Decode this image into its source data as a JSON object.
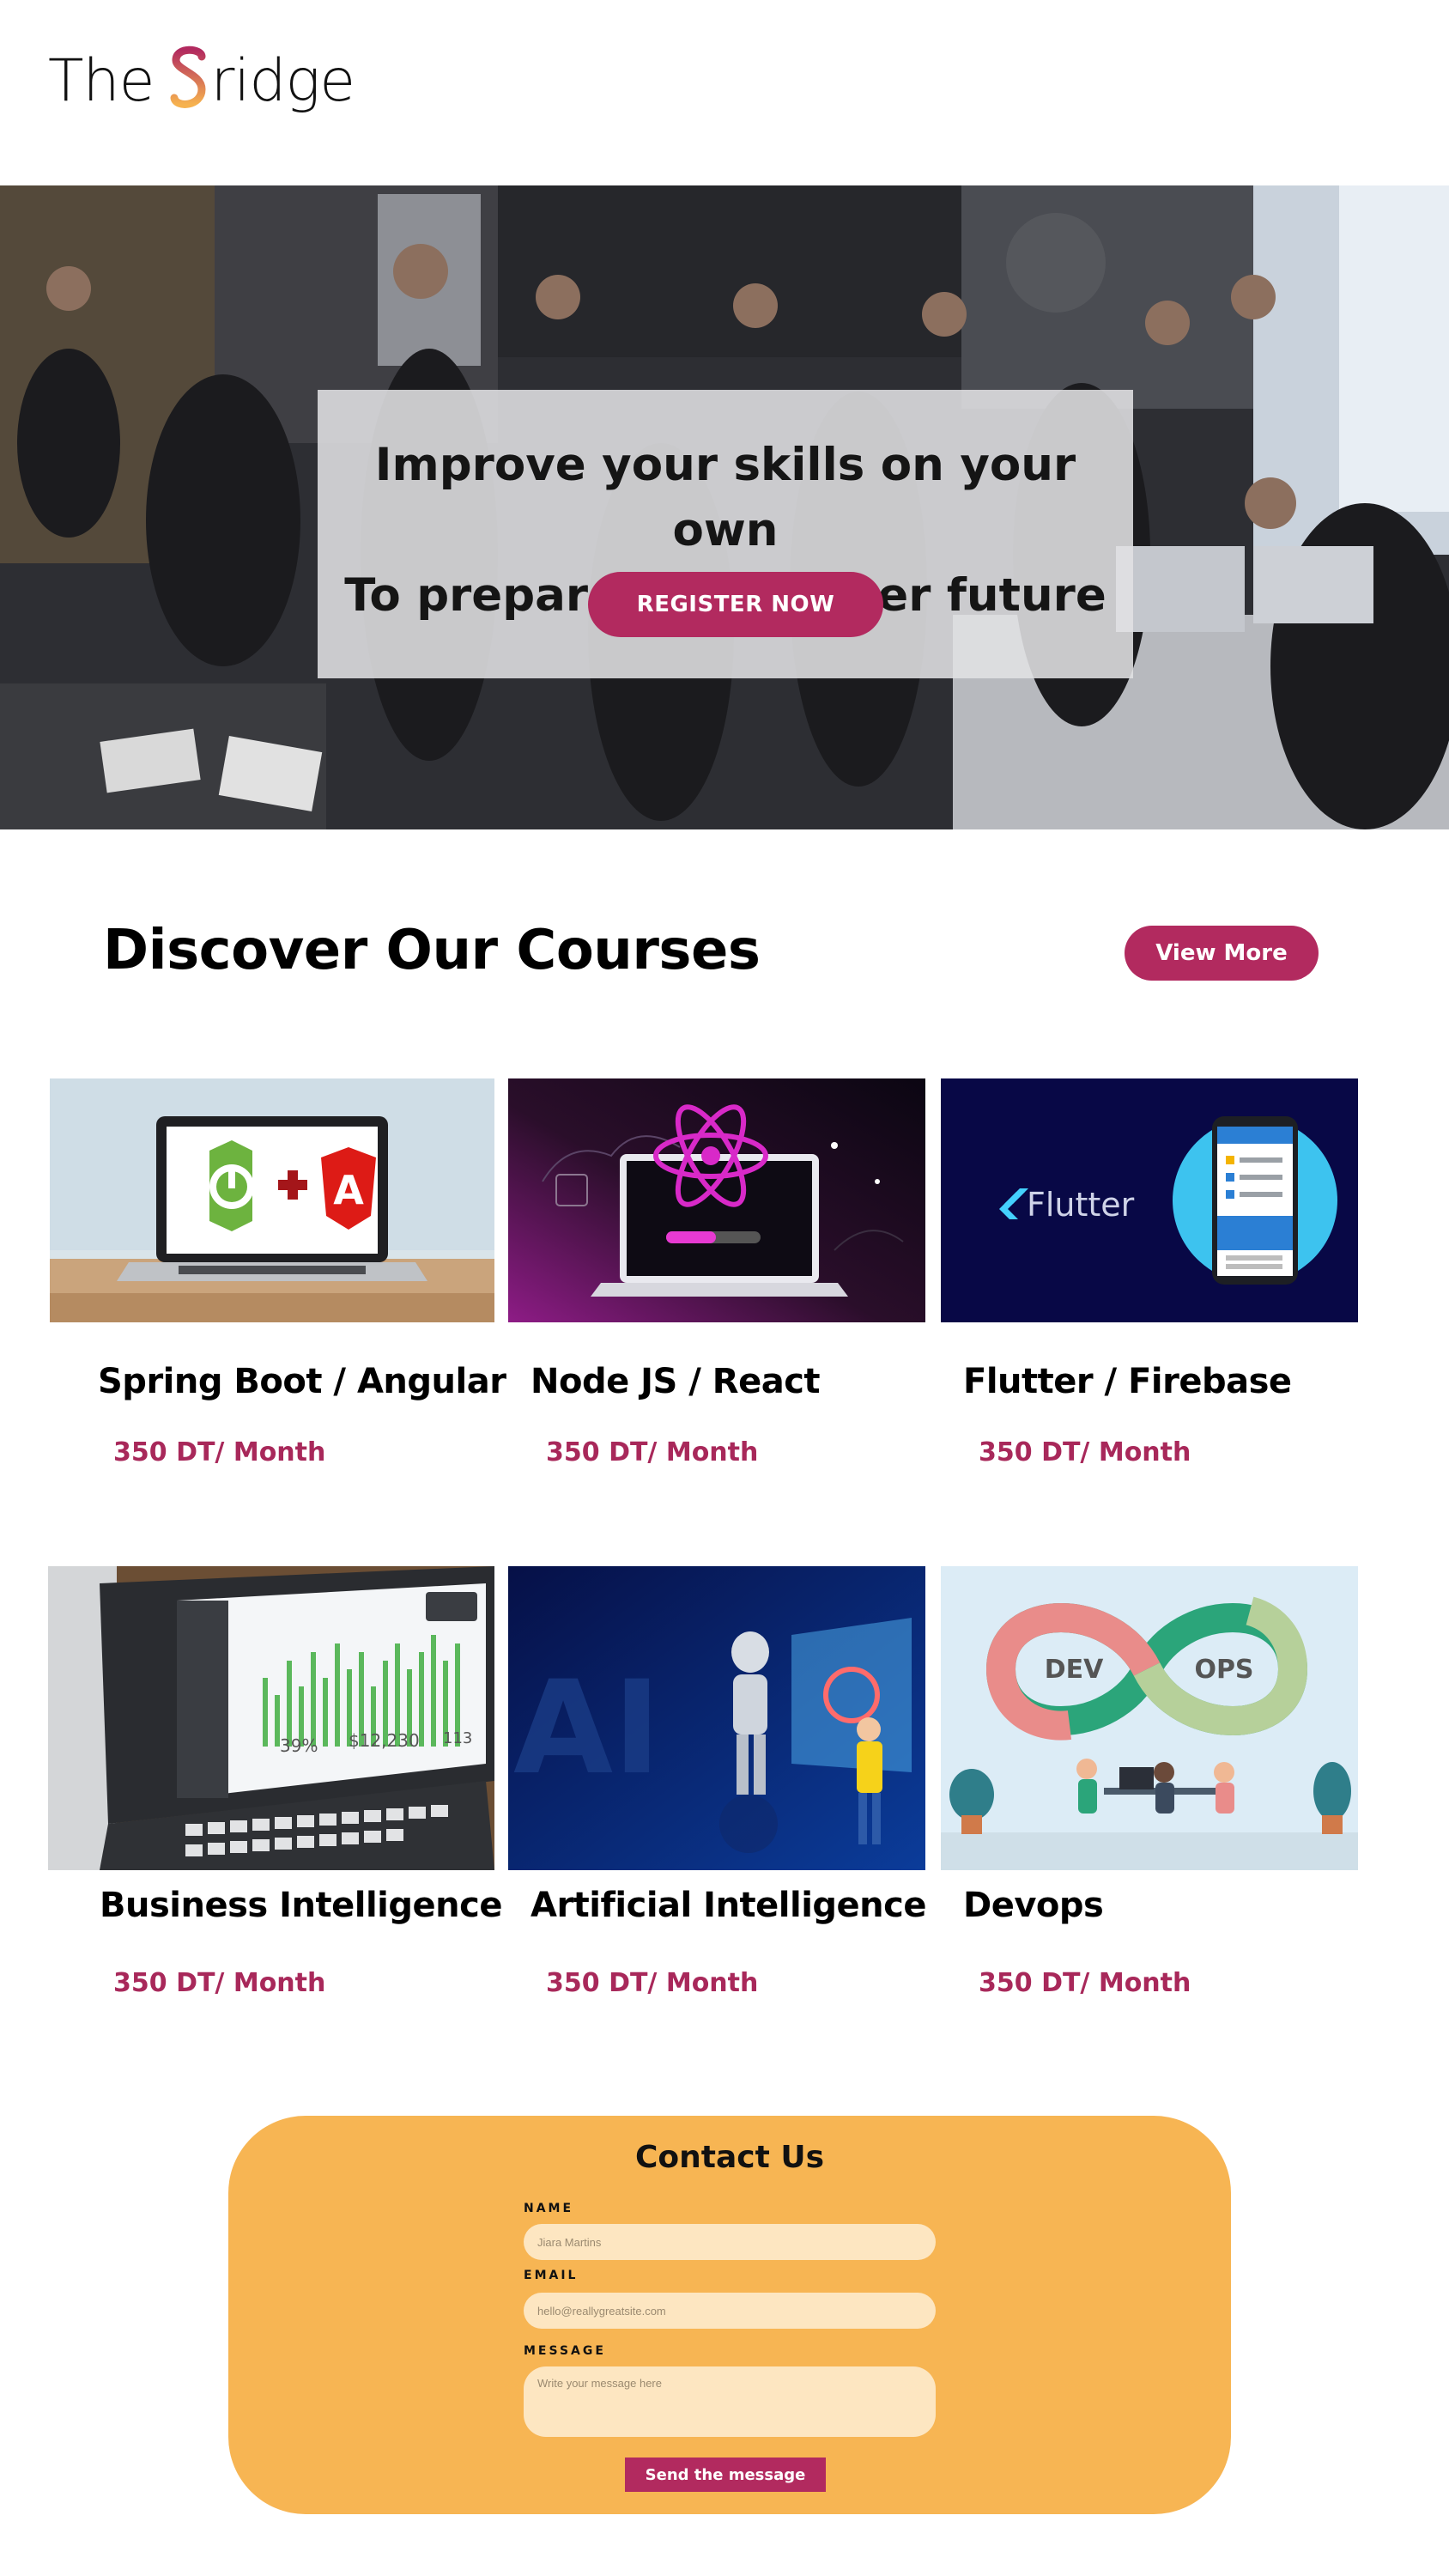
{
  "brand": {
    "logo_prefix": "The",
    "logo_suffix": "ridge",
    "logo_colors": {
      "gradient_top": "#b22a5f",
      "gradient_bottom": "#f6b24f"
    }
  },
  "hero": {
    "line1": "Improve your skills on your own",
    "line2": "To prepare for a better future",
    "register_label": "REGISTER NOW"
  },
  "courses": {
    "title": "Discover Our Courses",
    "view_more_label": "View More",
    "items": [
      {
        "name": "Spring Boot / Angular",
        "price": "350 DT/ Month",
        "icon": "laptop-spring-angular-icon"
      },
      {
        "name": "Node JS  / React",
        "price": "350 DT/ Month",
        "icon": "react-laptop-icon"
      },
      {
        "name": "Flutter / Firebase",
        "price": "350 DT/ Month",
        "icon": "flutter-phone-icon",
        "thumb_text": "Flutter"
      },
      {
        "name": "Business Intelligence",
        "price": "350 DT/ Month",
        "icon": "dashboard-laptop-icon",
        "thumb_stats": [
          "39%",
          "$12,230",
          "113"
        ]
      },
      {
        "name": "Artificial Intelligence",
        "price": "350 DT/ Month",
        "icon": "ai-robot-icon",
        "thumb_text": "AI"
      },
      {
        "name": "Devops",
        "price": "350 DT/ Month",
        "icon": "devops-infinity-icon",
        "thumb_labels": [
          "DEV",
          "OPS"
        ]
      }
    ]
  },
  "contact": {
    "title": "Contact Us",
    "name_label": "NAME",
    "name_placeholder": "Jiara Martins",
    "email_label": "EMAIL",
    "email_placeholder": "hello@reallygreatsite.com",
    "message_label": "MESSAGE",
    "message_placeholder": "Write your message here",
    "send_label": "Send the message"
  },
  "colors": {
    "accent": "#b22a5f",
    "price": "#a8285a",
    "contact_bg": "#f7b553",
    "field_bg": "#fde6c1"
  }
}
